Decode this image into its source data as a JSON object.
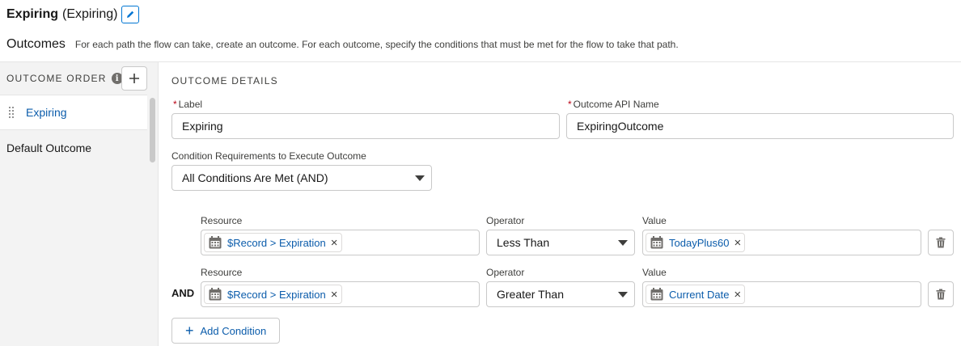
{
  "header": {
    "title": "Expiring",
    "subtitle": "(Expiring)"
  },
  "outcomes": {
    "title": "Outcomes",
    "description": "For each path the flow can take, create an outcome. For each outcome, specify the conditions that must be met for the flow to take that path."
  },
  "sidebar": {
    "order_label": "OUTCOME ORDER",
    "info_glyph": "i",
    "items": [
      {
        "label": "Expiring",
        "selected": true
      },
      {
        "label": "Default Outcome",
        "selected": false
      }
    ]
  },
  "details": {
    "title": "OUTCOME DETAILS",
    "label_field": {
      "label": "Label",
      "value": "Expiring"
    },
    "api_field": {
      "label": "Outcome API Name",
      "value": "ExpiringOutcome"
    },
    "requirement": {
      "label": "Condition Requirements to Execute Outcome",
      "value": "All Conditions Are Met (AND)"
    },
    "conditions": [
      {
        "logic": "",
        "resource_label": "Resource",
        "resource": "$Record > Expiration",
        "operator_label": "Operator",
        "operator": "Less Than",
        "value_label": "Value",
        "value": "TodayPlus60"
      },
      {
        "logic": "AND",
        "resource_label": "Resource",
        "resource": "$Record > Expiration",
        "operator_label": "Operator",
        "operator": "Greater Than",
        "value_label": "Value",
        "value": "Current Date"
      }
    ],
    "add_condition": "Add Condition"
  },
  "icons": {
    "remove": "×",
    "plus": "+",
    "names": [
      "pencil-icon",
      "info-icon",
      "plus-icon",
      "drag-handle-icon",
      "calendar-icon",
      "close-icon",
      "trash-icon",
      "chevron-down-icon"
    ]
  },
  "colors": {
    "link": "#0b5cab",
    "brand": "#0176d3",
    "required": "#ba0517",
    "sidebar_bg": "#f3f3f3"
  }
}
